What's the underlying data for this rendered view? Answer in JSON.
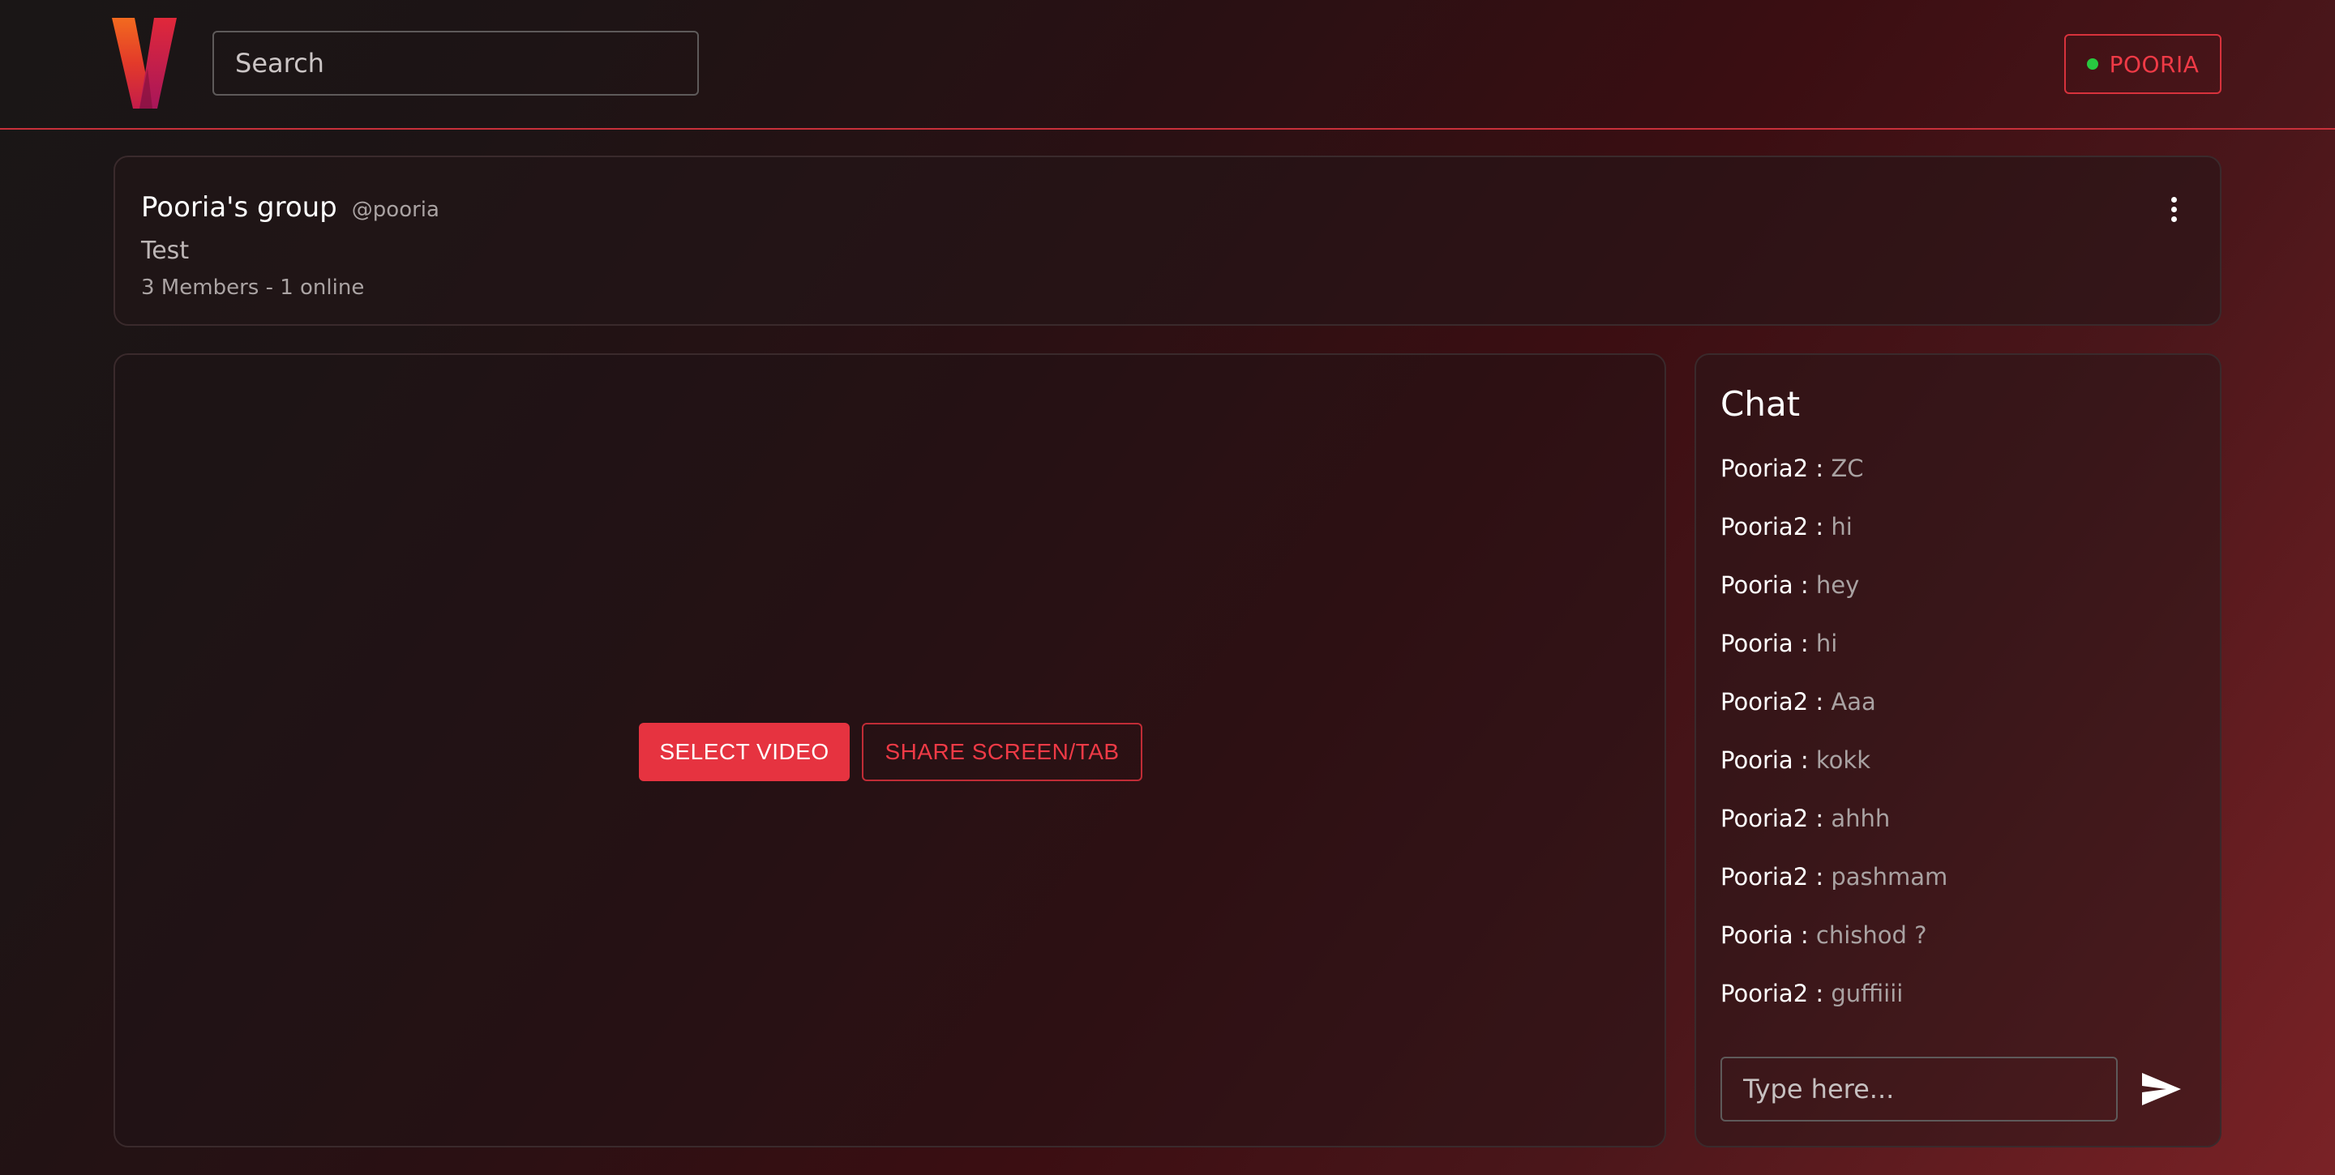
{
  "header": {
    "search_placeholder": "Search",
    "user_label": "POORIA",
    "status_color": "#28c840",
    "accent_color": "#e63340"
  },
  "group": {
    "name": "Pooria's group",
    "handle": "@pooria",
    "description": "Test",
    "members": "3 Members - 1 online"
  },
  "video": {
    "select_label": "SELECT VIDEO",
    "share_label": "SHARE SCREEN/TAB"
  },
  "chat": {
    "title": "Chat",
    "messages": [
      {
        "user": "Pooria2 :",
        "text": "ZC"
      },
      {
        "user": "Pooria2 :",
        "text": "hi"
      },
      {
        "user": "Pooria :",
        "text": "hey"
      },
      {
        "user": "Pooria :",
        "text": "hi"
      },
      {
        "user": "Pooria2 :",
        "text": "Aaa"
      },
      {
        "user": "Pooria :",
        "text": "kokk"
      },
      {
        "user": "Pooria2 :",
        "text": "ahhh"
      },
      {
        "user": "Pooria2 :",
        "text": "pashmam"
      },
      {
        "user": "Pooria :",
        "text": "chishod ?"
      },
      {
        "user": "Pooria2 :",
        "text": "guffiiii"
      }
    ],
    "input_placeholder": "Type here..."
  }
}
